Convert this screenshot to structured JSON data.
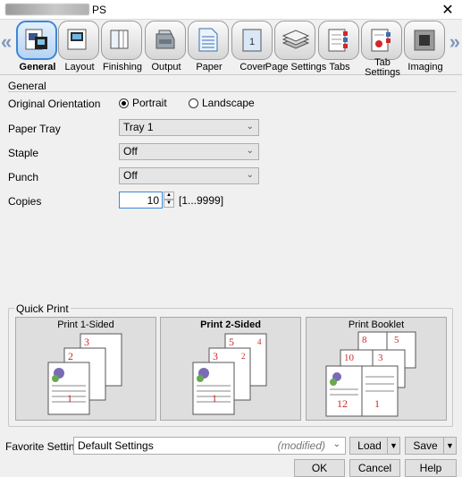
{
  "window": {
    "title": "PS",
    "close_glyph": "✕"
  },
  "tabs": [
    {
      "label": "General",
      "icon": "general-icon",
      "selected": true
    },
    {
      "label": "Layout",
      "icon": "layout-icon"
    },
    {
      "label": "Finishing",
      "icon": "finishing-icon"
    },
    {
      "label": "Output",
      "icon": "output-icon"
    },
    {
      "label": "Paper",
      "icon": "paper-icon"
    },
    {
      "label": "Cover",
      "icon": "cover-icon"
    },
    {
      "label": "Page Settings",
      "icon": "page-settings-icon"
    },
    {
      "label": "Tabs",
      "icon": "tabs-icon"
    },
    {
      "label": "Tab Settings",
      "icon": "tab-settings-icon"
    },
    {
      "label": "Imaging",
      "icon": "imaging-icon"
    }
  ],
  "tab_scroll": {
    "left": "«",
    "right": "»"
  },
  "general": {
    "section_title": "General",
    "orientation": {
      "label": "Original Orientation",
      "options": [
        "Portrait",
        "Landscape"
      ],
      "selected": "Portrait"
    },
    "paper_tray": {
      "label": "Paper Tray",
      "value": "Tray 1"
    },
    "staple": {
      "label": "Staple",
      "value": "Off"
    },
    "punch": {
      "label": "Punch",
      "value": "Off"
    },
    "copies": {
      "label": "Copies",
      "value": "10",
      "range": "[1...9999]"
    }
  },
  "quick_print": {
    "title": "Quick Print",
    "cards": [
      {
        "label": "Print 1-Sided",
        "pages": [
          "3",
          "2",
          "1"
        ],
        "selected": false
      },
      {
        "label": "Print 2-Sided",
        "pages": [
          "5",
          "4",
          "3",
          "2",
          "1"
        ],
        "selected": true
      },
      {
        "label": "Print Booklet",
        "pages": [
          "8",
          "5",
          "10",
          "3",
          "12",
          "1"
        ],
        "selected": false
      }
    ]
  },
  "footer": {
    "favorite_label": "Favorite Setting",
    "favorite_value": "Default Settings",
    "modified": "(modified)",
    "load": "Load",
    "save": "Save",
    "ok": "OK",
    "cancel": "Cancel",
    "help": "Help"
  },
  "colors": {
    "accent": "#3b88d8",
    "page_number": "#d0282a"
  }
}
